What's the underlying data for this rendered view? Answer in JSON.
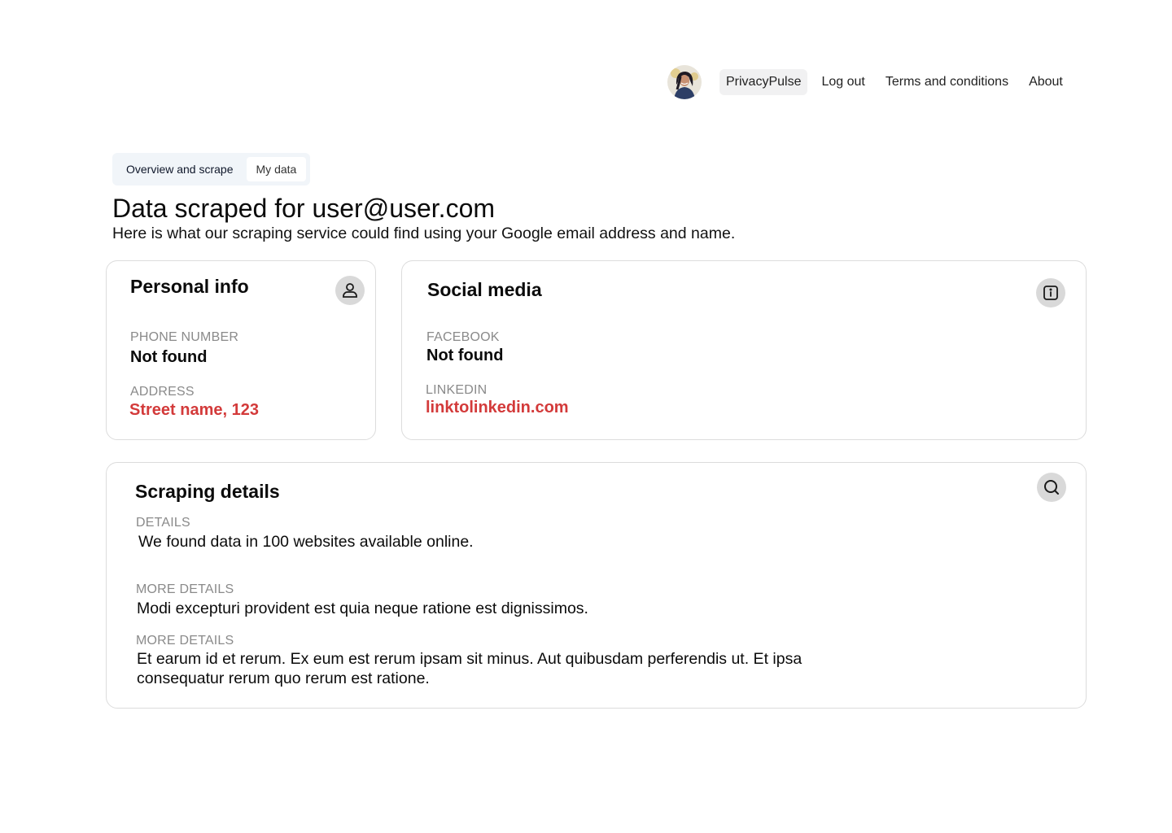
{
  "nav": {
    "brand": "PrivacyPulse",
    "links": [
      "Log out",
      "Terms and conditions",
      "About"
    ]
  },
  "tabs": [
    {
      "label": "Overview and scrape",
      "selected": false
    },
    {
      "label": "My data",
      "selected": true
    }
  ],
  "header": {
    "title": "Data scraped for user@user.com",
    "subtitle": "Here is what our scraping service could find using your Google email address and name."
  },
  "personal": {
    "title": "Personal info",
    "icon": "user-icon",
    "phone_label": "PHONE NUMBER",
    "phone_value": "Not found",
    "address_label": "ADDRESS",
    "address_value": "Street name, 123"
  },
  "social": {
    "title": "Social media",
    "icon": "info-icon",
    "facebook_label": "FACEBOOK",
    "facebook_value": "Not found",
    "linkedin_label": "LINKEDIN",
    "linkedin_value": "linktolinkedin.com"
  },
  "scraping": {
    "title": "Scraping details",
    "icon": "search-icon",
    "details_label": "DETAILS",
    "details_text": "We found data in 100 websites available online.",
    "more1_label": "MORE DETAILS",
    "more1_text": "Modi excepturi provident est quia neque ratione est dignissimos.",
    "more2_label": "MORE DETAILS",
    "more2_text": "Et earum id et rerum. Ex eum est rerum ipsam sit minus. Aut quibusdam perferendis ut. Et ipsa consequatur rerum quo rerum est ratione."
  },
  "colors": {
    "alert": "#d33a3a",
    "label": "#8a8a8a",
    "icon_bg": "#d9d9d9",
    "tab_bg": "#f1f5f9",
    "border": "#dcdcdc"
  }
}
